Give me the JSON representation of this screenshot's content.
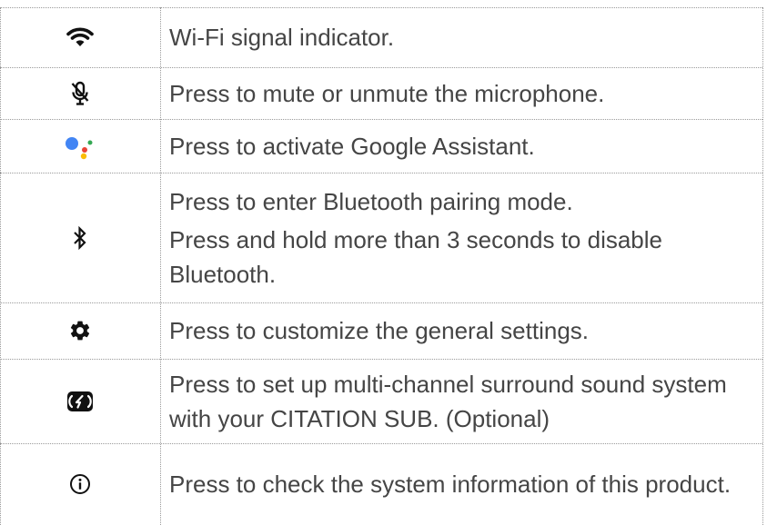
{
  "rows": [
    {
      "icon": "wifi-icon",
      "lines": [
        "Wi-Fi signal indicator."
      ]
    },
    {
      "icon": "microphone-muted-icon",
      "lines": [
        "Press to mute or unmute the microphone."
      ]
    },
    {
      "icon": "google-assistant-icon",
      "lines": [
        "Press to activate Google Assistant."
      ]
    },
    {
      "icon": "bluetooth-icon",
      "lines": [
        "Press to enter Bluetooth pairing mode.",
        "Press and hold more than 3 seconds to disable Bluetooth."
      ]
    },
    {
      "icon": "gear-icon",
      "lines": [
        "Press to customize the general settings."
      ]
    },
    {
      "icon": "surround-sound-icon",
      "lines": [
        "Press to set up multi-channel surround sound system with your CITATION SUB. (Optional)"
      ]
    },
    {
      "icon": "info-icon",
      "lines": [
        "Press to check the system information of this product."
      ]
    }
  ],
  "colors": {
    "text": "#454545",
    "icon": "#111111",
    "assistant_blue": "#4285F4",
    "assistant_red": "#EA4335",
    "assistant_yellow": "#FBBC05",
    "assistant_green": "#34A853"
  }
}
